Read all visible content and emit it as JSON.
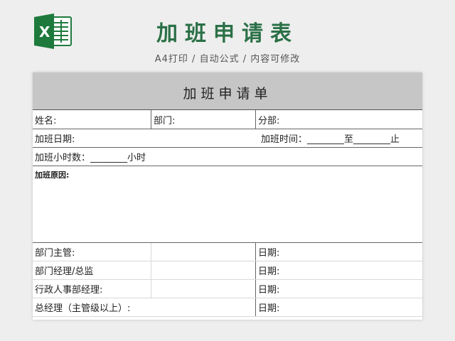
{
  "banner": {
    "title": "加班申请表",
    "subtitle": "A4打印 / 自动公式 / 内容可修改",
    "logo_icon": "excel-icon",
    "brand_color": "#2b7047"
  },
  "form": {
    "title": "加班申请单",
    "row1": {
      "name": "姓名:",
      "dept": "部门:",
      "division": "分部:"
    },
    "row2": {
      "date": "加班日期:",
      "time": "加班时间：________至________止"
    },
    "row3": {
      "hours": "加班小时数：________小时"
    },
    "row4": {
      "reason": "加班原因:"
    },
    "approvals": [
      {
        "role": "部门主管:",
        "date": "日期:"
      },
      {
        "role": "部门经理/总监",
        "date": "日期:"
      },
      {
        "role": "行政人事部经理:",
        "date": "日期:"
      },
      {
        "role": "总经理（主管级以上）:",
        "date": "日期:"
      }
    ]
  }
}
